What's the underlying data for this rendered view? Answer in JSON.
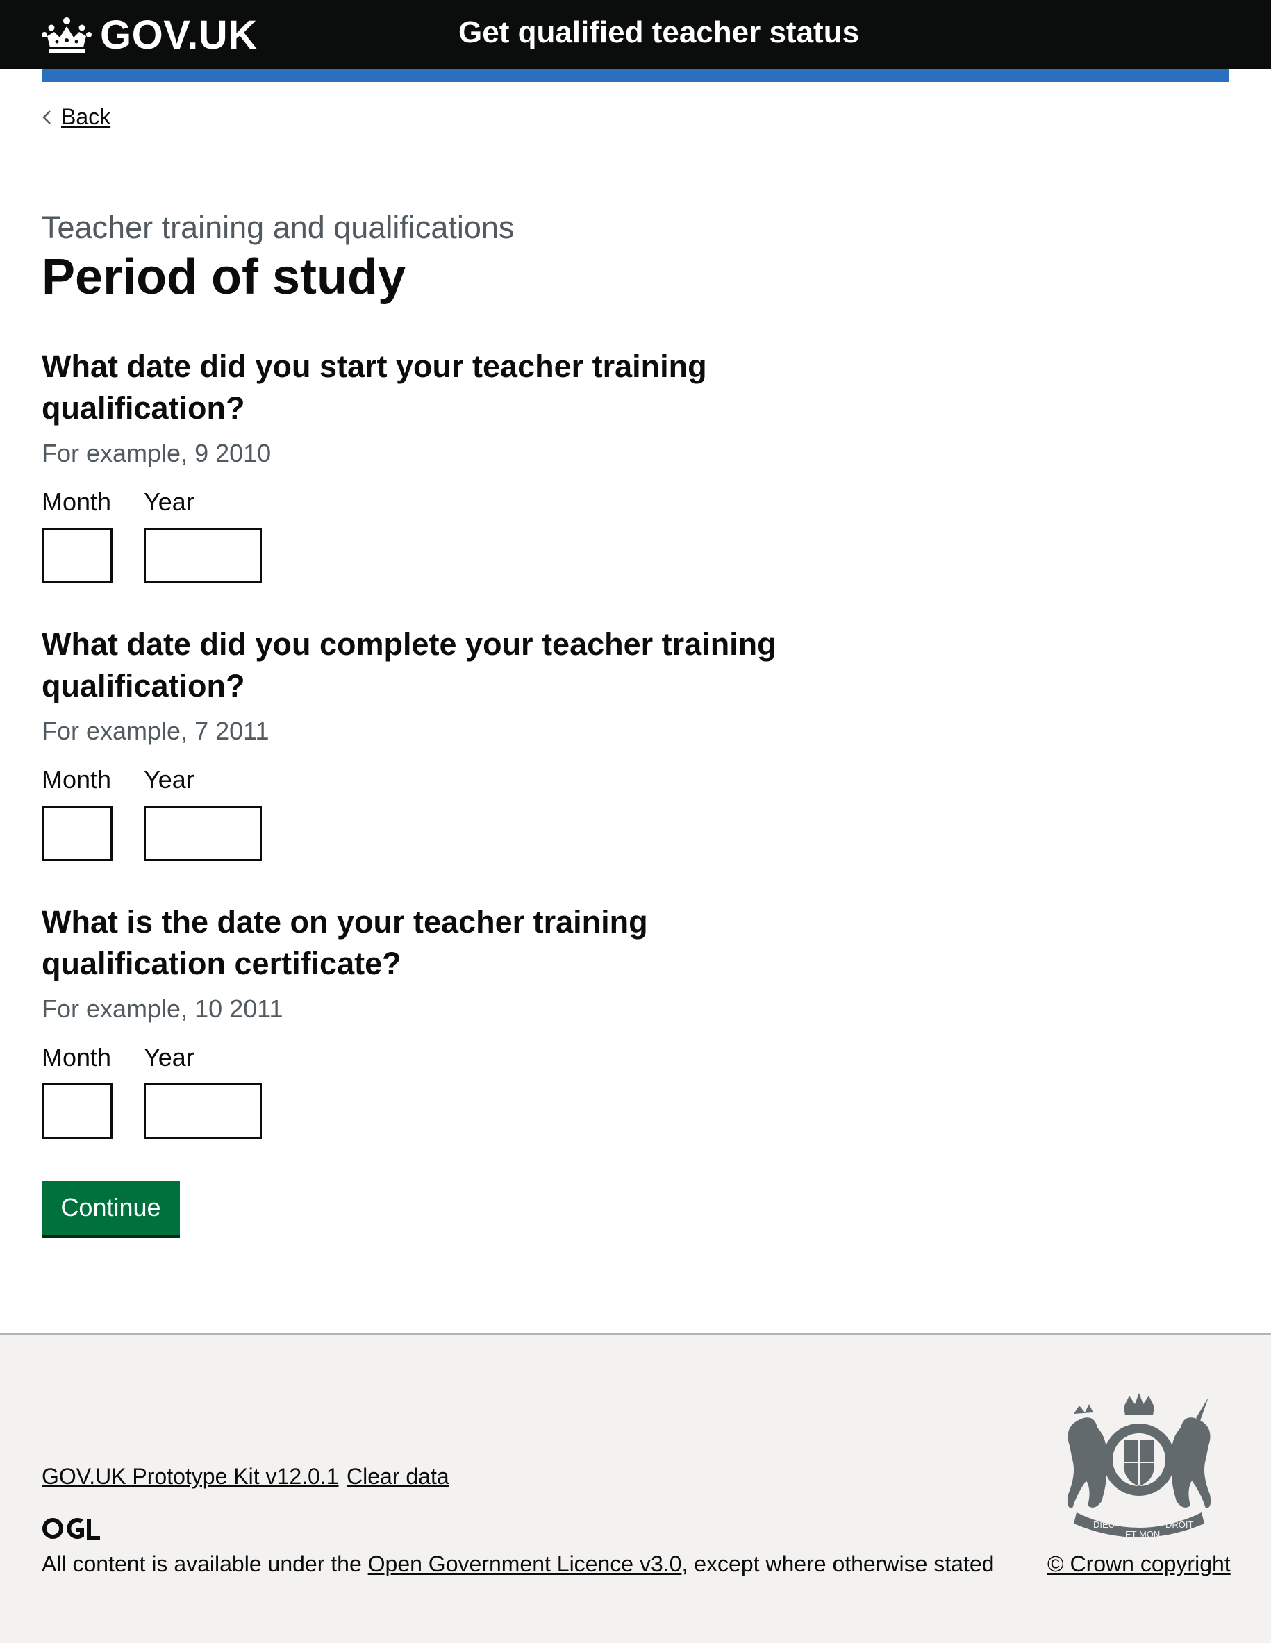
{
  "header": {
    "logo_text": "GOV.UK",
    "service_name": "Get qualified teacher status",
    "colors": {
      "background": "#0b0c0c",
      "accent_bar": "#2b70bf"
    }
  },
  "back_link": {
    "label": "Back"
  },
  "main": {
    "caption": "Teacher training and qualifications",
    "title": "Period of study",
    "questions": [
      {
        "legend_line1": "What date did you start your teacher training",
        "legend_line2": "qualification?",
        "hint": "For example, 9 2010",
        "month_label": "Month",
        "year_label": "Year",
        "month_value": "",
        "year_value": ""
      },
      {
        "legend_line1": "What date did you complete your teacher training",
        "legend_line2": "qualification?",
        "hint": "For example, 7 2011",
        "month_label": "Month",
        "year_label": "Year",
        "month_value": "",
        "year_value": ""
      },
      {
        "legend_line1": "What is the date on your teacher training",
        "legend_line2": "qualification certificate?",
        "hint": "For example, 10 2011",
        "month_label": "Month",
        "year_label": "Year",
        "month_value": "",
        "year_value": ""
      }
    ],
    "continue_label": "Continue",
    "button_color": "#00703c"
  },
  "footer": {
    "prototype_kit_link": "GOV.UK Prototype Kit v12.0.1",
    "clear_data_link": "Clear data",
    "ogl_logo": "ogl-logo",
    "licence_prefix": "All content is available under the ",
    "licence_link": "Open Government Licence v3.0",
    "licence_suffix": ", except where otherwise stated",
    "crown_copyright": "© Crown copyright",
    "crest_motto_left": "DIEU",
    "crest_motto_middle": "ET MON",
    "crest_motto_right": "DROIT",
    "background": "#f3f2f1"
  }
}
